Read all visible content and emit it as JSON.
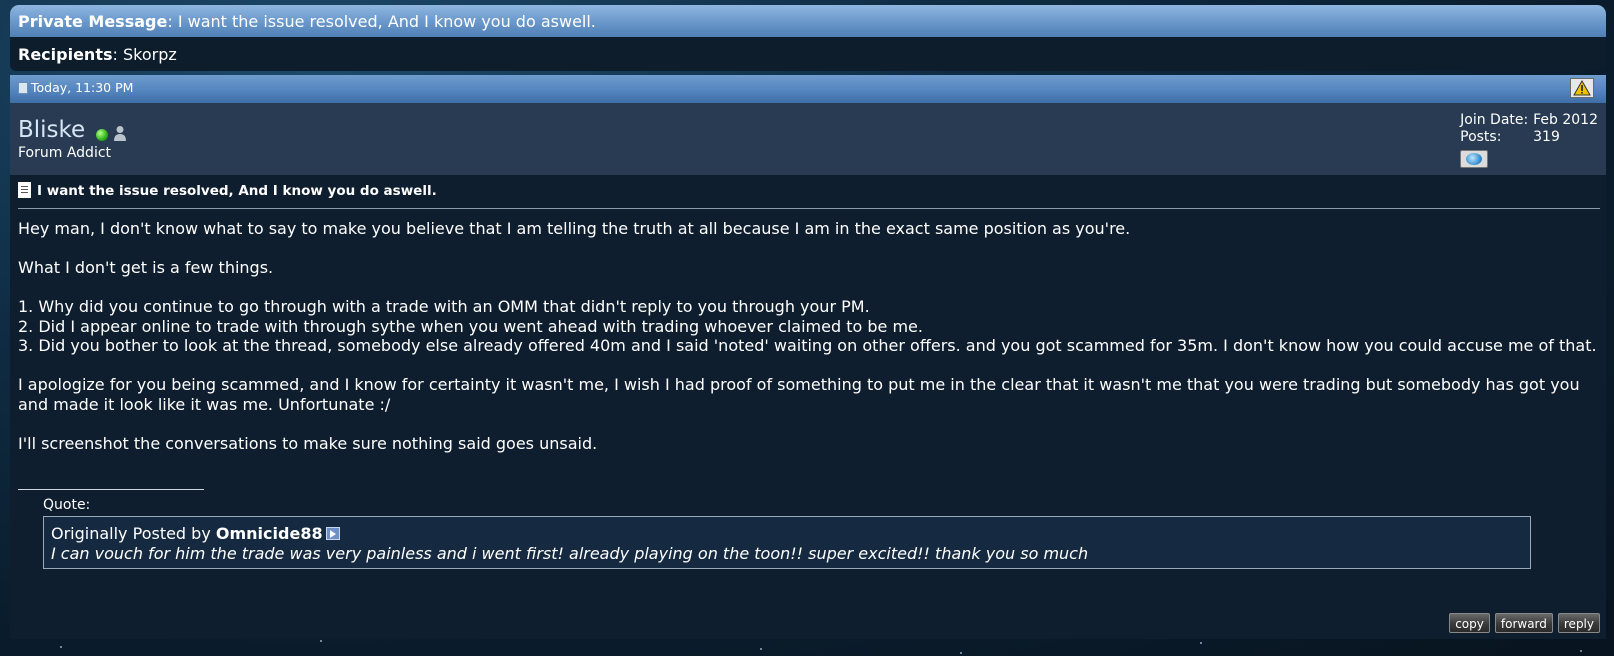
{
  "pm_header": {
    "label": "Private Message",
    "subject": "I want the issue resolved, And I know you do aswell."
  },
  "recipients": {
    "label": "Recipients",
    "value": "Skorpz"
  },
  "post": {
    "date": "Today, 11:30 PM",
    "username": "Bliske",
    "user_title": "Forum Addict",
    "join_date_label": "Join Date:",
    "join_date": "Feb 2012",
    "posts_label": "Posts:",
    "posts": "319",
    "title": "I want the issue resolved, And I know you do aswell.",
    "body": "Hey man, I don't know what to say to make you believe that I am telling the truth at all because I am in the exact same position as you're.\n\nWhat I don't get is a few things.\n\n1. Why did you continue to go through with a trade with an OMM that didn't reply to you through your PM.\n2. Did I appear online to trade with through sythe when you went ahead with trading whoever claimed to be me.\n3. Did you bother to look at the thread, somebody else already offered 40m and I said 'noted' waiting on other offers. and you got scammed for 35m. I don't know how you could accuse me of that.\n\nI apologize for you being scammed, and I know for certainty it wasn't me, I wish I had proof of something to put me in the clear that it wasn't me that you were trading but somebody has got you and made it look like it was me. Unfortunate :/\n\nI'll screenshot the conversations to make sure nothing said goes unsaid.",
    "quote_label": "Quote:",
    "quote_prefix": "Originally Posted by",
    "quote_author": "Omnicide88",
    "quote_text": "I can vouch for him the trade was very painless and i went first! already playing on the toon!! super excited!! thank you so much"
  },
  "buttons": {
    "copy": "copy",
    "forward": "forward",
    "reply": "reply"
  }
}
